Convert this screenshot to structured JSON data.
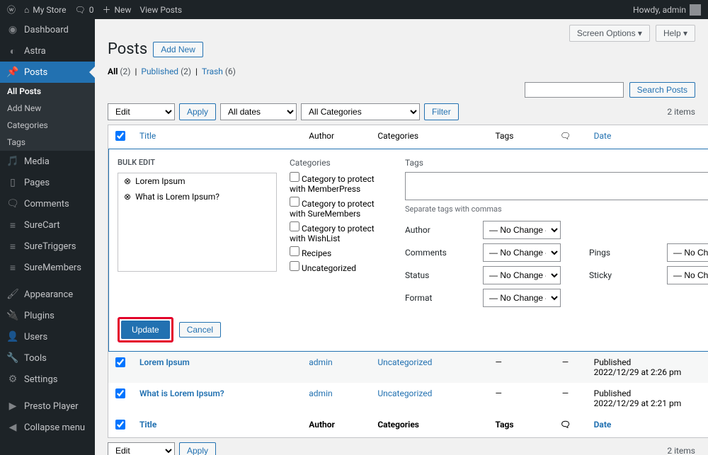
{
  "adminbar": {
    "site_name": "My Store",
    "comment_count": "0",
    "new": "New",
    "view_posts": "View Posts",
    "howdy": "Howdy, admin"
  },
  "sidebar": {
    "dashboard": "Dashboard",
    "astra": "Astra",
    "posts": "Posts",
    "sub": {
      "all_posts": "All Posts",
      "add_new": "Add New",
      "categories": "Categories",
      "tags": "Tags"
    },
    "media": "Media",
    "pages": "Pages",
    "comments": "Comments",
    "surecart": "SureCart",
    "suretriggers": "SureTriggers",
    "suremembers": "SureMembers",
    "appearance": "Appearance",
    "plugins": "Plugins",
    "users": "Users",
    "tools": "Tools",
    "settings": "Settings",
    "presto": "Presto Player",
    "collapse": "Collapse menu"
  },
  "top_actions": {
    "screen_options": "Screen Options",
    "help": "Help"
  },
  "heading": {
    "title": "Posts",
    "add_new": "Add New"
  },
  "filters_row": {
    "all": "All",
    "all_count": "(2)",
    "published": "Published",
    "published_count": "(2)",
    "trash": "Trash",
    "trash_count": "(6)"
  },
  "search": {
    "button": "Search Posts"
  },
  "tablenav": {
    "bulk_action": "Edit",
    "apply": "Apply",
    "all_dates": "All dates",
    "all_categories": "All Categories",
    "filter": "Filter",
    "items_count": "2 items"
  },
  "columns": {
    "title": "Title",
    "author": "Author",
    "categories": "Categories",
    "tags": "Tags",
    "date": "Date"
  },
  "bulk": {
    "label": "BULK EDIT",
    "items": [
      "Lorem Ipsum",
      "What is Lorem Ipsum?"
    ],
    "cat_label": "Categories",
    "categories": [
      "Category to protect with MemberPress",
      "Category to protect with SureMembers",
      "Category to protect with WishList",
      "Recipes",
      "Uncategorized"
    ],
    "tags_label": "Tags",
    "tags_hint": "Separate tags with commas",
    "author_label": "Author",
    "comments_label": "Comments",
    "status_label": "Status",
    "format_label": "Format",
    "pings_label": "Pings",
    "sticky_label": "Sticky",
    "no_change": "— No Change —",
    "update": "Update",
    "cancel": "Cancel"
  },
  "rows": [
    {
      "title": "Lorem Ipsum",
      "author": "admin",
      "category": "Uncategorized",
      "tags": "—",
      "comments": "—",
      "date_status": "Published",
      "date": "2022/12/29 at 2:26 pm"
    },
    {
      "title": "What is Lorem Ipsum?",
      "author": "admin",
      "category": "Uncategorized",
      "tags": "—",
      "comments": "—",
      "date_status": "Published",
      "date": "2022/12/29 at 2:21 pm"
    }
  ]
}
